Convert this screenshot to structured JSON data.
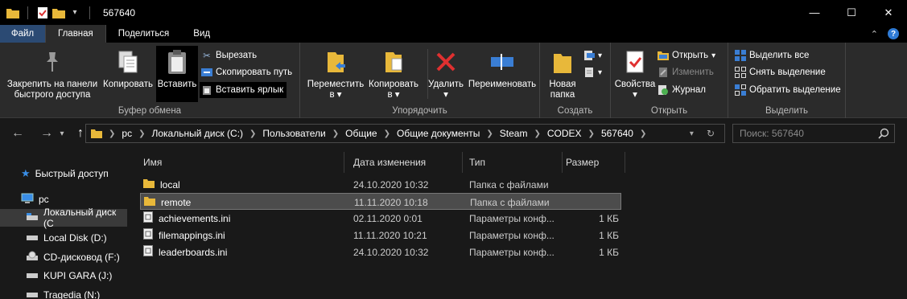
{
  "window": {
    "title": "567640",
    "buttons": {
      "minimize": "—",
      "maximize": "☐",
      "close": "✕"
    }
  },
  "tabs": [
    {
      "label": "Файл"
    },
    {
      "label": "Главная"
    },
    {
      "label": "Поделиться"
    },
    {
      "label": "Вид"
    }
  ],
  "ribbon": {
    "clipboard": {
      "label": "Буфер обмена",
      "pin_label_1": "Закрепить на панели",
      "pin_label_2": "быстрого доступа",
      "copy": "Копировать",
      "paste": "Вставить",
      "cut": "Вырезать",
      "copy_path": "Скопировать путь",
      "paste_shortcut": "Вставить ярлык"
    },
    "organize": {
      "label": "Упорядочить",
      "move_1": "Переместить",
      "move_2": "в",
      "copy_1": "Копировать",
      "copy_2": "в",
      "delete": "Удалить",
      "rename": "Переименовать"
    },
    "new": {
      "label": "Создать",
      "folder_1": "Новая",
      "folder_2": "папка"
    },
    "open": {
      "label": "Открыть",
      "properties": "Свойства",
      "open": "Открыть",
      "edit": "Изменить",
      "history": "Журнал"
    },
    "select": {
      "label": "Выделить",
      "select_all": "Выделить все",
      "select_none": "Снять выделение",
      "invert": "Обратить выделение"
    }
  },
  "address": {
    "crumbs": [
      "pc",
      "Локальный диск (C:)",
      "Пользователи",
      "Общие",
      "Общие документы",
      "Steam",
      "CODEX",
      "567640"
    ]
  },
  "search": {
    "placeholder": "Поиск: 567640"
  },
  "nav": {
    "items": [
      {
        "label": "Быстрый доступ",
        "icon": "star-icon"
      },
      {
        "label": "pc",
        "icon": "computer-icon"
      },
      {
        "label": "Локальный диск (C",
        "icon": "drive-icon"
      },
      {
        "label": "Local Disk (D:)",
        "icon": "drive-icon"
      },
      {
        "label": "CD-дисковод (F:)",
        "icon": "cd-icon"
      },
      {
        "label": "KUPI GARA (J:)",
        "icon": "drive-icon"
      },
      {
        "label": "Tragedia (N:)",
        "icon": "drive-icon"
      }
    ]
  },
  "columns": {
    "name": "Имя",
    "date": "Дата изменения",
    "type": "Тип",
    "size": "Размер"
  },
  "files": [
    {
      "name": "local",
      "date": "24.10.2020 10:32",
      "type": "Папка с файлами",
      "size": "",
      "kind": "folder"
    },
    {
      "name": "remote",
      "date": "11.11.2020 10:18",
      "type": "Папка с файлами",
      "size": "",
      "kind": "folder"
    },
    {
      "name": "achievements.ini",
      "date": "02.11.2020 0:01",
      "type": "Параметры конф...",
      "size": "1 КБ",
      "kind": "ini"
    },
    {
      "name": "filemappings.ini",
      "date": "11.11.2020 10:21",
      "type": "Параметры конф...",
      "size": "1 КБ",
      "kind": "ini"
    },
    {
      "name": "leaderboards.ini",
      "date": "24.10.2020 10:32",
      "type": "Параметры конф...",
      "size": "1 КБ",
      "kind": "ini"
    }
  ],
  "colors": {
    "accent": "#2b4a73",
    "folder": "#e8b83a",
    "selection": "#4c4c4c"
  }
}
